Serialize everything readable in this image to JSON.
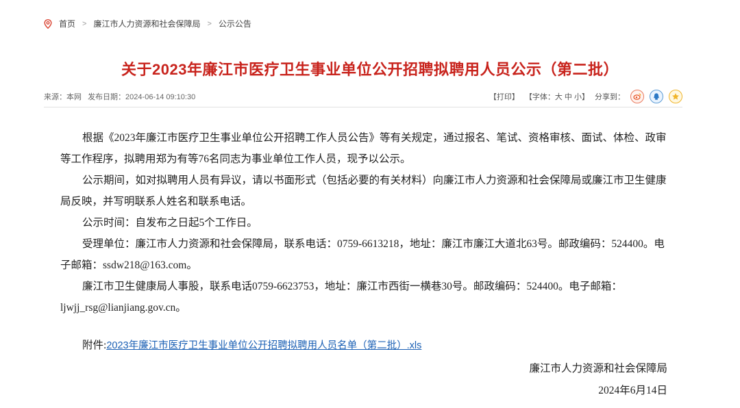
{
  "breadcrumb": {
    "home": "首页",
    "level1": "廉江市人力资源和社会保障局",
    "level2": "公示公告"
  },
  "article": {
    "title": "关于2023年廉江市医疗卫生事业单位公开招聘拟聘用人员公示（第二批）",
    "source_label": "来源：本网",
    "date_label": "发布日期：2024-06-14 09:10:30",
    "print_label": "【打印】",
    "font_label": "【字体：大 中 小】",
    "share_label": "分享到：",
    "share_icons": [
      "weibo-icon",
      "qq-icon",
      "favorite-icon"
    ],
    "paragraphs": [
      "根据《2023年廉江市医疗卫生事业单位公开招聘工作人员公告》等有关规定，通过报名、笔试、资格审核、面试、体检、政审等工作程序，拟聘用郑为有等76名同志为事业单位工作人员，现予以公示。",
      "公示期间，如对拟聘用人员有异议，请以书面形式（包括必要的有关材料）向廉江市人力资源和社会保障局或廉江市卫生健康局反映，并写明联系人姓名和联系电话。",
      "公示时间：自发布之日起5个工作日。",
      "受理单位：廉江市人力资源和社会保障局，联系电话：0759-6613218，地址：廉江市廉江大道北63号。邮政编码：524400。电子邮箱：ssdw218@163.com。",
      "廉江市卫生健康局人事股，联系电话0759-6623753，地址：廉江市西街一横巷30号。邮政编码：524400。电子邮箱：ljwjj_rsg@lianjiang.gov.cn。"
    ],
    "attachment_label": "附件:",
    "attachment_link": "2023年廉江市医疗卫生事业单位公开招聘拟聘用人员名单（第二批）.xls",
    "signature_org": "廉江市人力资源和社会保障局",
    "signature_date": "2024年6月14日"
  },
  "colors": {
    "title": "#c8231c",
    "link": "#1a5fb4"
  }
}
